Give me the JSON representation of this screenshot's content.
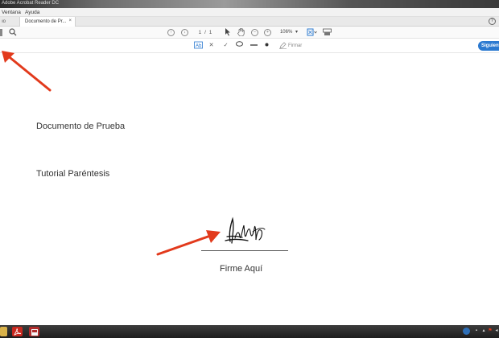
{
  "window": {
    "title_fragment": "Adobe Acrobat Reader DC"
  },
  "menu": {
    "items": [
      "Ventana",
      "Ayuda"
    ]
  },
  "tabs": {
    "left_partial": "Inicio",
    "active": "Documento de Pr...",
    "close": "×"
  },
  "toolbar": {
    "page_current": "1",
    "page_sep": "/",
    "page_total": "1",
    "zoom": "106%",
    "zoom_caret": "▾"
  },
  "signbar": {
    "firmar": "Firmar",
    "next_button": "Siguiente"
  },
  "document": {
    "line1": "Documento de Prueba",
    "line2": "Tutorial Paréntesis",
    "caption": "Firme Aquí"
  },
  "colors": {
    "accent": "#2b79d0",
    "arrow": "#e23a1c"
  },
  "icons": [
    "search-icon",
    "help-icon",
    "arrow-up-icon",
    "arrow-down-icon",
    "select-cursor-icon",
    "hand-icon",
    "zoom-out-icon",
    "zoom-in-icon",
    "fit-page-icon",
    "keyboard-icon",
    "text-field-icon",
    "cross-icon",
    "check-icon",
    "ellipse-icon",
    "line-icon",
    "dot-icon",
    "sign-pen-icon"
  ]
}
